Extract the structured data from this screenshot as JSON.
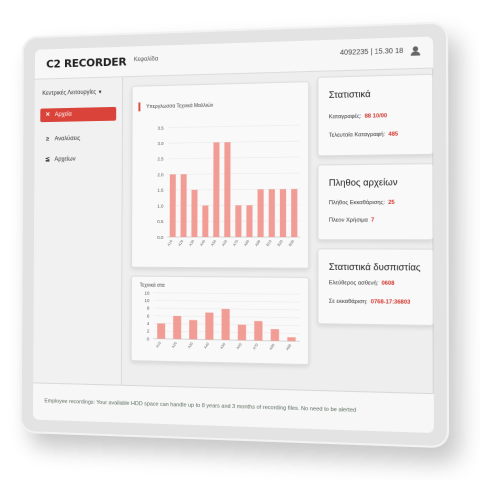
{
  "app": {
    "logo": "C2 RECORDER",
    "breadcrumb": "Κεφαλίδα",
    "stamp": "4092235 | 15.30 18"
  },
  "sidebar": {
    "dropdown_label": "Κεντρικές Λειτουργίες",
    "items": [
      {
        "icon": "✕",
        "label": "Αρχεία",
        "active": true
      },
      {
        "icon": "≥",
        "label": "Αναλύσεις",
        "active": false
      },
      {
        "icon": "≦",
        "label": "Αρχείων",
        "active": false
      }
    ]
  },
  "chart_main": {
    "title": "Υπεργλωσσα Τεχνικά Μαλλιών",
    "x_labels": [
      "A10",
      "A20",
      "A30",
      "A40",
      "A50",
      "A60",
      "A70",
      "A80",
      "A90",
      "B10",
      "B20",
      "B30"
    ]
  },
  "chart_small": {
    "title": "Τεχνικά στα",
    "x_labels": [
      "A10",
      "A20",
      "A30",
      "A40",
      "A50",
      "A60",
      "A70",
      "A80",
      "A90"
    ]
  },
  "chart_data": [
    {
      "type": "bar",
      "title": "Υπεργλωσσα Τεχνικά Μαλλιών",
      "categories": [
        "A10",
        "A20",
        "A30",
        "A40",
        "A50",
        "A60",
        "A70",
        "A80",
        "A90",
        "B10",
        "B20",
        "B30"
      ],
      "values": [
        2.0,
        2.0,
        1.5,
        1.0,
        3.0,
        3.0,
        1.0,
        1.0,
        1.5,
        1.5,
        1.5,
        1.5
      ],
      "y_ticks": [
        "3.5",
        "3.0",
        "2.5",
        "2.0",
        "1.5",
        "1.0",
        "0.5",
        "0.0"
      ],
      "ylim": [
        0,
        3.5
      ]
    },
    {
      "type": "bar",
      "title": "Τεχνικά στα",
      "categories": [
        "A10",
        "A20",
        "A30",
        "A40",
        "A50",
        "A60",
        "A70",
        "A80",
        "A90"
      ],
      "values": [
        4,
        6,
        5,
        7,
        8,
        4,
        5,
        3,
        1
      ],
      "y_ticks": [
        "10",
        "10",
        "8",
        "6",
        "4",
        "2",
        "0"
      ],
      "ylim": [
        0,
        12
      ]
    }
  ],
  "cards": [
    {
      "title": "Στατιστικά",
      "rows": [
        {
          "label": "Καταγραφές:",
          "value": "88 10/00"
        },
        {
          "label": "Τελευταία Καταγραφή:",
          "value": "485"
        }
      ]
    },
    {
      "title": "Πληθος αρχείων",
      "rows": [
        {
          "label": "Πλήθος Εκκαθάρισης:",
          "value": "25"
        },
        {
          "label": "Πλεον Χρήσιμα",
          "value": "7"
        }
      ]
    },
    {
      "title": "Στατιστικά δυσπιστίας",
      "rows": [
        {
          "label": "Ελεύθερος ασθενή:",
          "value": "0608"
        },
        {
          "label": "Σε εκκαθάριση:",
          "value": "0768-17:36803"
        }
      ]
    }
  ],
  "footer": {
    "text": "Employee recordings: Your available HDD space can handle up to 8 years and 3 months of recording files. No need to be alerted"
  },
  "colors": {
    "accent": "#d9433a",
    "bar": "#f19c94",
    "bar_dark": "#e77468"
  }
}
